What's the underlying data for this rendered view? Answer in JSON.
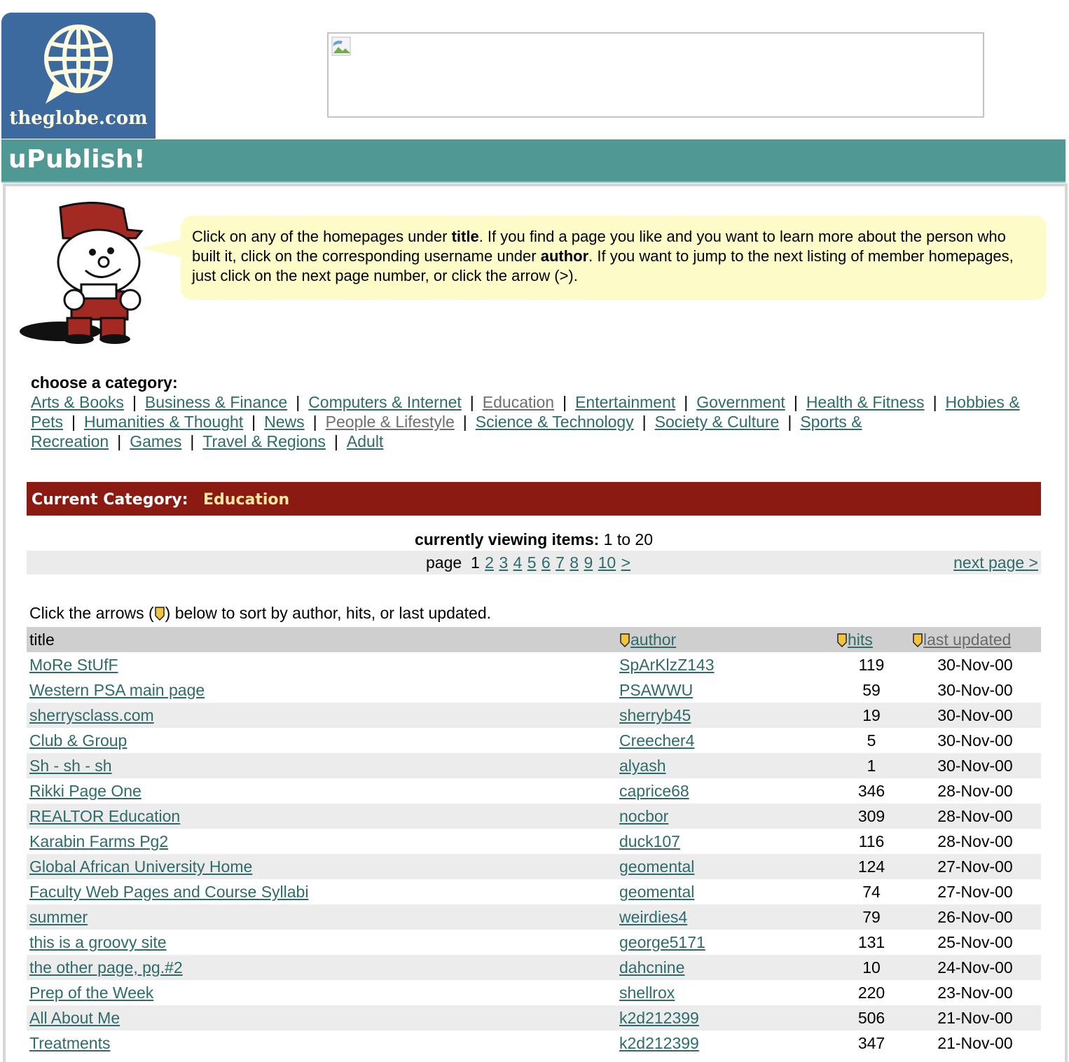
{
  "logo": {
    "text": "theglobe.com"
  },
  "section_title": "uPublish!",
  "intro": {
    "p1": "Click on any of the homepages under ",
    "b1": "title",
    "p2": ". If you find a page you like and you want to learn more about the person who built it, click on the corresponding username under ",
    "b2": "author",
    "p3": ". If you want to jump to the next listing of member homepages, just click on the next page number, or click the arrow (>)."
  },
  "categories": {
    "label": "choose a category:",
    "items": [
      {
        "label": "Arts & Books"
      },
      {
        "label": "Business & Finance"
      },
      {
        "label": "Computers & Internet"
      },
      {
        "label": "Education"
      },
      {
        "label": "Entertainment"
      },
      {
        "label": "Government"
      },
      {
        "label": "Health & Fitness"
      },
      {
        "label": "Hobbies & Pets"
      },
      {
        "label": "Humanities & Thought"
      },
      {
        "label": "News"
      },
      {
        "label": "People & Lifestyle"
      },
      {
        "label": "Science & Technology"
      },
      {
        "label": "Society & Culture"
      },
      {
        "label": "Sports & Recreation"
      },
      {
        "label": "Games"
      },
      {
        "label": "Travel & Regions"
      },
      {
        "label": "Adult"
      }
    ],
    "separator": "|"
  },
  "current_category": {
    "label": "Current Category:",
    "value": "Education"
  },
  "viewing": {
    "label": "currently viewing items:",
    "range": "1 to 20"
  },
  "pager": {
    "label": "page",
    "current": "1",
    "pages": [
      "2",
      "3",
      "4",
      "5",
      "6",
      "7",
      "8",
      "9",
      "10"
    ],
    "arrow": ">",
    "next": "next page >"
  },
  "sort_note": {
    "before": "Click the arrows (",
    "after": ") below to sort by author, hits, or last updated."
  },
  "table": {
    "headers": {
      "title": "title",
      "author": "author",
      "hits": "hits",
      "updated": "last updated"
    },
    "rows": [
      {
        "title": "MoRe StUfF",
        "author": "SpArKlzZ143",
        "hits": "119",
        "updated": "30-Nov-00"
      },
      {
        "title": "Western PSA main page",
        "author": "PSAWWU",
        "hits": "59",
        "updated": "30-Nov-00"
      },
      {
        "title": "sherrysclass.com",
        "author": "sherryb45",
        "hits": "19",
        "updated": "30-Nov-00"
      },
      {
        "title": "Club & Group",
        "author": "Creecher4",
        "hits": "5",
        "updated": "30-Nov-00"
      },
      {
        "title": "Sh - sh - sh",
        "author": "alyash",
        "hits": "1",
        "updated": "30-Nov-00"
      },
      {
        "title": "Rikki Page One",
        "author": "caprice68",
        "hits": "346",
        "updated": "28-Nov-00"
      },
      {
        "title": "REALTOR Education",
        "author": "nocbor",
        "hits": "309",
        "updated": "28-Nov-00"
      },
      {
        "title": "Karabin Farms Pg2",
        "author": "duck107",
        "hits": "116",
        "updated": "28-Nov-00"
      },
      {
        "title": "Global African University Home",
        "author": "geomental",
        "hits": "124",
        "updated": "27-Nov-00"
      },
      {
        "title": "Faculty Web Pages and Course Syllabi",
        "author": "geomental",
        "hits": "74",
        "updated": "27-Nov-00"
      },
      {
        "title": "summer",
        "author": "weirdies4",
        "hits": "79",
        "updated": "26-Nov-00"
      },
      {
        "title": "this is a groovy site",
        "author": "george5171",
        "hits": "131",
        "updated": "25-Nov-00"
      },
      {
        "title": "the other page, pg.#2",
        "author": "dahcnine",
        "hits": "10",
        "updated": "24-Nov-00"
      },
      {
        "title": "Prep of the Week",
        "author": "shellrox",
        "hits": "220",
        "updated": "23-Nov-00"
      },
      {
        "title": "All About Me",
        "author": "k2d212399",
        "hits": "506",
        "updated": "21-Nov-00"
      },
      {
        "title": "Treatments",
        "author": "k2d212399",
        "hits": "347",
        "updated": "21-Nov-00"
      }
    ]
  },
  "colors": {
    "brand_blue": "#3d6a9e",
    "upublish_teal": "#4f9894",
    "link_teal": "#2e6b6b",
    "category_bar": "#8b1a12",
    "bubble": "#fdfbc7"
  },
  "icons": {
    "logo": "globe-speech-icon",
    "sort": "sort-arrow-icon",
    "banner": "broken-image-icon",
    "mascot": "mascot-illustration"
  }
}
